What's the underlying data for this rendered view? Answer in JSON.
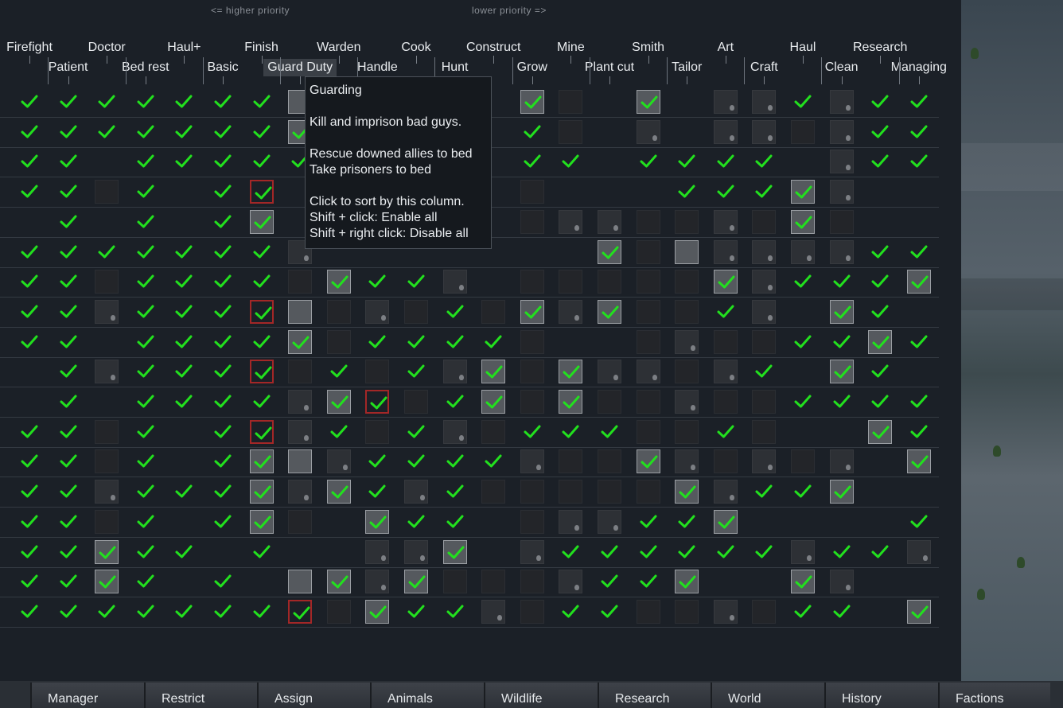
{
  "priority_hints": {
    "higher": "<= higher priority",
    "lower": "lower priority =>"
  },
  "columns": [
    {
      "label": "Firefight"
    },
    {
      "label": "Patient"
    },
    {
      "label": "Doctor"
    },
    {
      "label": "Bed rest"
    },
    {
      "label": "Haul+"
    },
    {
      "label": "Basic"
    },
    {
      "label": "Finish"
    },
    {
      "label": "Guard Duty"
    },
    {
      "label": "Warden"
    },
    {
      "label": "Handle"
    },
    {
      "label": "Cook"
    },
    {
      "label": "Hunt"
    },
    {
      "label": "Construct"
    },
    {
      "label": "Grow"
    },
    {
      "label": "Mine"
    },
    {
      "label": "Plant cut"
    },
    {
      "label": "Smith"
    },
    {
      "label": "Tailor"
    },
    {
      "label": "Art"
    },
    {
      "label": "Craft"
    },
    {
      "label": "Haul"
    },
    {
      "label": "Clean"
    },
    {
      "label": "Research"
    },
    {
      "label": "Managing"
    }
  ],
  "tooltip": {
    "title": "Guarding",
    "line1": "Kill and imprison bad guys.",
    "line2": "Rescue downed allies to bed",
    "line3": "Take prisoners to bed",
    "line4": "Click to sort by this column.",
    "line5": "Shift + click: Enable all",
    "line6": "Shift + right click: Disable all"
  },
  "grid": {
    "legend": "c = checked, L = checked (lit box), R = checked (red box), l = lit empty, d = dark empty, m = mid empty, . = none",
    "rows": [
      "cccccccl.....Ld.L.mmcmccdc",
      "cccccccL.....cd.m.mmdmccdL",
      "cc.cccccL....cc.cccc.mccdm",
      "ccdc.cR......d...cccLm..LL",
      ".c.c.cL......dmmddmdLd..dL",
      "cccccccm.......Ldlmmmmccccc",
      "ccdccccdLccm.dddddLmcccL",
      "ccmcccRldmdcdLmLddcm.Lc",
      "cc.ccccLdccccd..dmddccLc",
      ".cmcccRdcdcmLdLmmdmc.Lc",
      ".c.ccccmLRdcLdLddmddcccc",
      "ccdc.cRmcdcmdcccddcd..Lc",
      "ccdc.cLlmccccmddLmdmdm.Lc",
      "ccmcccLmLcmcdddddLmccL",
      "ccdc.cLd.Lcc.dmmccL....c",
      "ccLcc.c..mmL.mccccccmccm",
      "ccLc.c.lLmLdddmccL..Lm.",
      "cccccccRdLccmdccddmdcc.L"
    ]
  },
  "tabs": [
    {
      "label": "Manager"
    },
    {
      "label": "Restrict"
    },
    {
      "label": "Assign"
    },
    {
      "label": "Animals"
    },
    {
      "label": "Wildlife"
    },
    {
      "label": "Research"
    },
    {
      "label": "World"
    },
    {
      "label": "History"
    },
    {
      "label": "Factions"
    }
  ],
  "colors": {
    "check": "#22e01e",
    "red_border": "#a32727",
    "panel": "#1b2027"
  }
}
